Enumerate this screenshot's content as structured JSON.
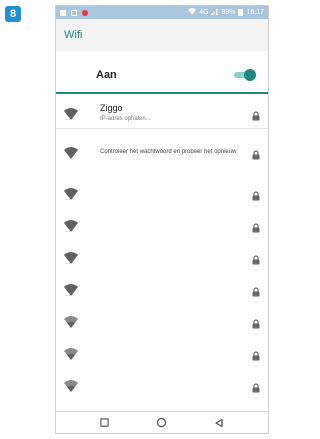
{
  "step_badge": "8",
  "status_bar": {
    "network": "4G",
    "battery": "89%",
    "time": "16:17"
  },
  "app_bar": {
    "title": "Wifi"
  },
  "wifi_switch": {
    "label": "Aan",
    "state": "on"
  },
  "networks": [
    {
      "name": "Ziggo",
      "status": "IP-adres ophalen...",
      "secured": true,
      "signal": "strong"
    },
    {
      "name": "",
      "status": "Controleer het wachtwoord en probeer het opnieuw",
      "secured": true,
      "signal": "strong"
    },
    {
      "name": "",
      "status": "",
      "secured": true,
      "signal": "strong"
    },
    {
      "name": "",
      "status": "",
      "secured": true,
      "signal": "strong"
    },
    {
      "name": "",
      "status": "",
      "secured": true,
      "signal": "strong"
    },
    {
      "name": "",
      "status": "",
      "secured": true,
      "signal": "strong"
    },
    {
      "name": "",
      "status": "",
      "secured": true,
      "signal": "medium"
    },
    {
      "name": "",
      "status": "",
      "secured": true,
      "signal": "medium"
    },
    {
      "name": "",
      "status": "",
      "secured": true,
      "signal": "medium"
    }
  ],
  "nav_bar": {
    "recents_icon": "square-icon",
    "home_icon": "circle-icon",
    "back_icon": "triangle-left-icon"
  },
  "colors": {
    "accent": "#1c8a7e",
    "status_bar": "#a9c6dc",
    "badge": "#1e90d6"
  }
}
